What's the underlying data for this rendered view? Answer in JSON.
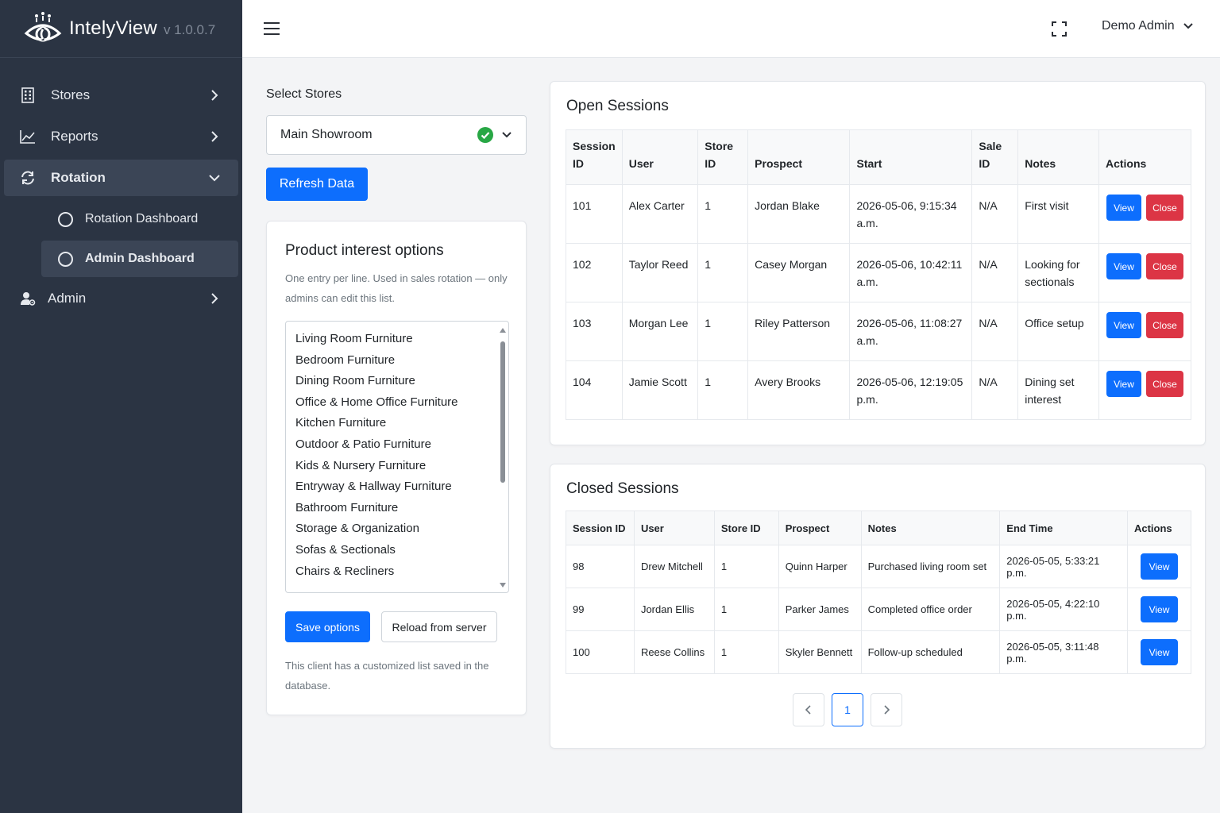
{
  "brand": {
    "name": "IntelyView",
    "version": "v 1.0.0.7"
  },
  "sidebar": {
    "items": [
      {
        "label": "Stores",
        "icon": "building-icon"
      },
      {
        "label": "Reports",
        "icon": "chart-line-icon"
      },
      {
        "label": "Rotation",
        "icon": "sync-icon",
        "expanded": true
      },
      {
        "label": "Admin",
        "icon": "user-cog-icon"
      }
    ],
    "rotation_children": [
      {
        "label": "Rotation Dashboard"
      },
      {
        "label": "Admin Dashboard",
        "active": true
      }
    ]
  },
  "topbar": {
    "user_name": "Demo Admin"
  },
  "store_select": {
    "label": "Select Stores",
    "value": "Main Showroom"
  },
  "refresh_label": "Refresh Data",
  "options_card": {
    "title": "Product interest options",
    "help": "One entry per line. Used in sales rotation — only admins can edit this list.",
    "options": [
      "Living Room Furniture",
      "Bedroom Furniture",
      "Dining Room Furniture",
      "Office & Home Office Furniture",
      "Kitchen Furniture",
      "Outdoor & Patio Furniture",
      "Kids & Nursery Furniture",
      "Entryway & Hallway Furniture",
      "Bathroom Furniture",
      "Storage & Organization",
      "Sofas & Sectionals",
      "Chairs & Recliners"
    ],
    "save_label": "Save options",
    "reload_label": "Reload from server",
    "footnote": "This client has a customized list saved in the database."
  },
  "open_sessions": {
    "title": "Open Sessions",
    "headers": {
      "session_id_1": "Session",
      "session_id_2": "ID",
      "user": "User",
      "store_id_1": "Store",
      "store_id_2": "ID",
      "prospect": "Prospect",
      "start": "Start",
      "sale_id_1": "Sale",
      "sale_id_2": "ID",
      "notes": "Notes",
      "actions": "Actions"
    },
    "view_label": "View",
    "close_label": "Close",
    "rows": [
      {
        "session_id": "101",
        "user": "Alex Carter",
        "store_id": "1",
        "prospect": "Jordan Blake",
        "start_1": "2026-05-06, 9:15:34",
        "start_2": "a.m.",
        "sale_id": "N/A",
        "notes_1": "First visit",
        "notes_2": ""
      },
      {
        "session_id": "102",
        "user": "Taylor Reed",
        "store_id": "1",
        "prospect": "Casey Morgan",
        "start_1": "2026-05-06, 10:42:11",
        "start_2": "a.m.",
        "sale_id": "N/A",
        "notes_1": "Looking for",
        "notes_2": "sectionals"
      },
      {
        "session_id": "103",
        "user": "Morgan Lee",
        "store_id": "1",
        "prospect": "Riley Patterson",
        "start_1": "2026-05-06, 11:08:27",
        "start_2": "a.m.",
        "sale_id": "N/A",
        "notes_1": "Office setup",
        "notes_2": ""
      },
      {
        "session_id": "104",
        "user": "Jamie Scott",
        "store_id": "1",
        "prospect": "Avery Brooks",
        "start_1": "2026-05-06, 12:19:05",
        "start_2": "p.m.",
        "sale_id": "N/A",
        "notes_1": "Dining set",
        "notes_2": "interest"
      }
    ]
  },
  "closed_sessions": {
    "title": "Closed Sessions",
    "headers": [
      "Session ID",
      "User",
      "Store ID",
      "Prospect",
      "Notes",
      "End Time",
      "Actions"
    ],
    "view_label": "View",
    "rows": [
      {
        "session_id": "98",
        "user": "Drew Mitchell",
        "store_id": "1",
        "prospect": "Quinn Harper",
        "notes": "Purchased living room set",
        "end_time": "2026-05-05, 5:33:21 p.m."
      },
      {
        "session_id": "99",
        "user": "Jordan Ellis",
        "store_id": "1",
        "prospect": "Parker James",
        "notes": "Completed office order",
        "end_time": "2026-05-05, 4:22:10 p.m."
      },
      {
        "session_id": "100",
        "user": "Reese Collins",
        "store_id": "1",
        "prospect": "Skyler Bennett",
        "notes": "Follow-up scheduled",
        "end_time": "2026-05-05, 3:11:48 p.m."
      }
    ]
  },
  "pagination": {
    "current_page": "1"
  },
  "colors": {
    "sidebar_bg": "#2b3443",
    "primary": "#0d6efd",
    "danger": "#dc3545",
    "success": "#28a745"
  }
}
